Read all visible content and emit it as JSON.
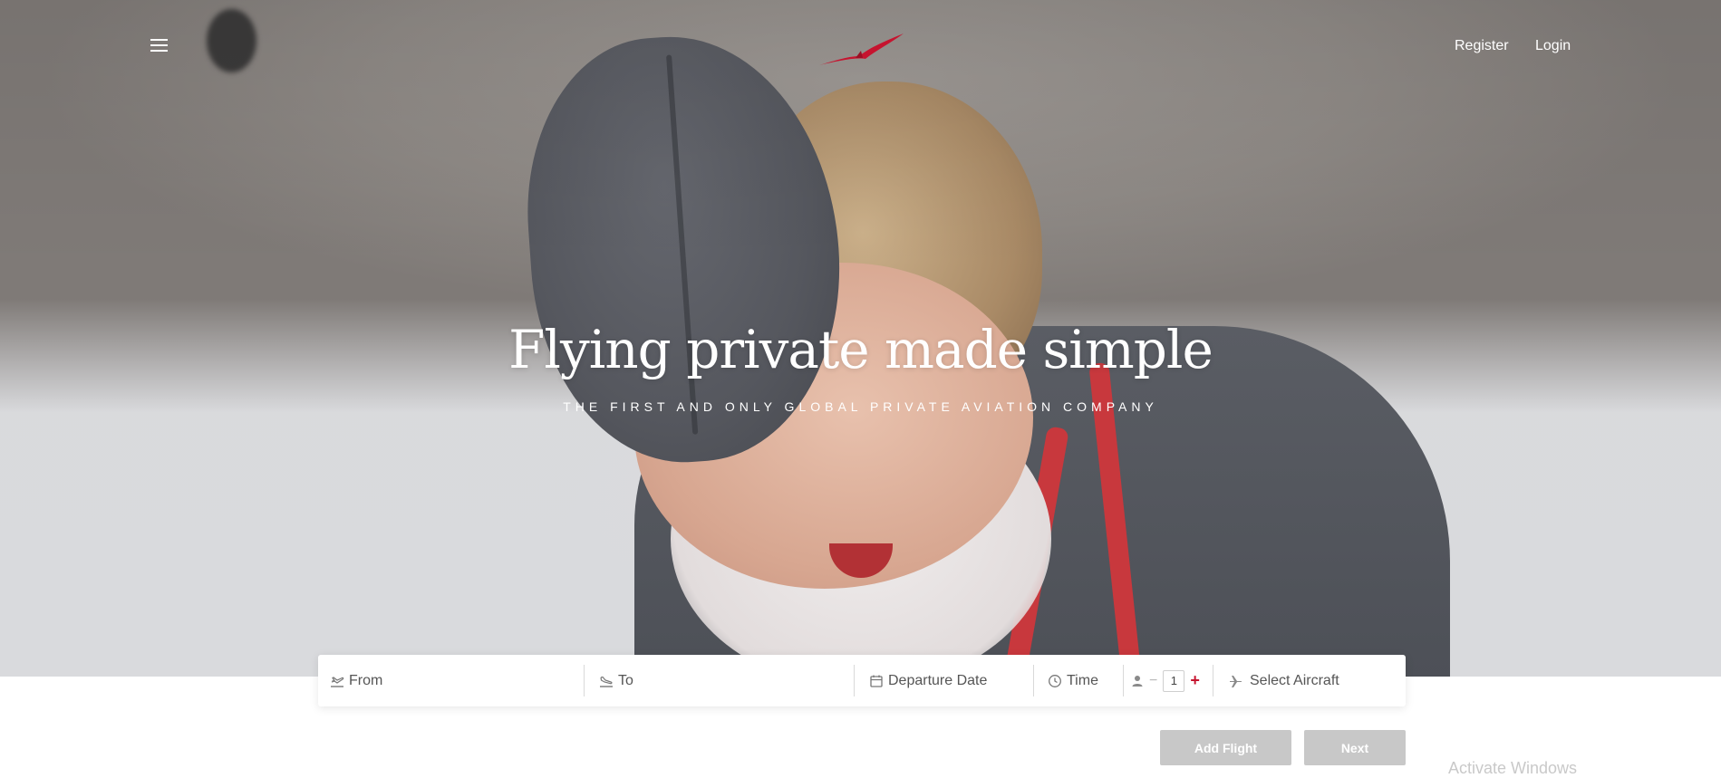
{
  "header": {
    "register_label": "Register",
    "login_label": "Login",
    "menu_icon": "hamburger-menu-icon",
    "logo_icon": "bird-logo-icon"
  },
  "hero": {
    "title": "Flying private made simple",
    "subtitle": "THE FIRST AND ONLY GLOBAL PRIVATE AVIATION COMPANY"
  },
  "search": {
    "from_placeholder": "From",
    "to_placeholder": "To",
    "date_placeholder": "Departure Date",
    "time_placeholder": "Time",
    "passengers": "1",
    "aircraft_placeholder": "Select Aircraft",
    "icons": {
      "from": "plane-takeoff-icon",
      "to": "plane-landing-icon",
      "date": "calendar-icon",
      "time": "clock-icon",
      "passenger": "person-icon",
      "aircraft": "airplane-icon"
    }
  },
  "actions": {
    "add_flight_label": "Add Flight",
    "next_label": "Next"
  },
  "system": {
    "watermark": "Activate Windows"
  },
  "colors": {
    "accent": "#c6142f",
    "button_disabled": "#c8c8c8",
    "search_bg": "#ffffff"
  }
}
